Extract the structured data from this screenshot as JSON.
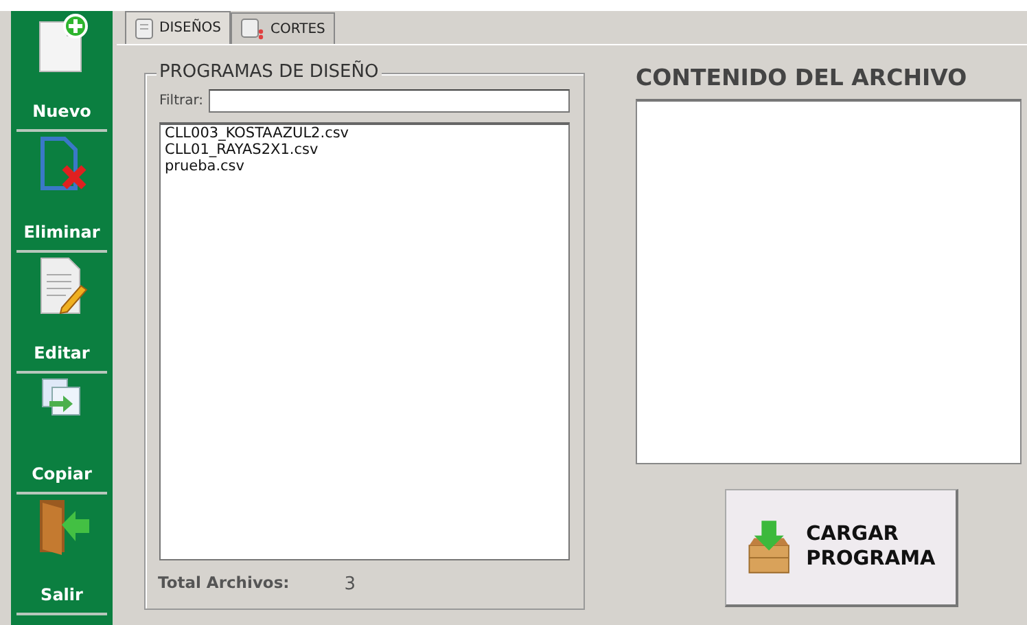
{
  "sidebar": {
    "items": [
      {
        "label": "Nuevo",
        "kind": "new"
      },
      {
        "label": "Eliminar",
        "kind": "delete"
      },
      {
        "label": "Editar",
        "kind": "edit"
      },
      {
        "label": "Copiar",
        "kind": "copy"
      },
      {
        "label": "Salir",
        "kind": "exit"
      }
    ]
  },
  "tabs": [
    {
      "label": "DISEÑOS",
      "selected": true,
      "kind": "document"
    },
    {
      "label": "CORTES",
      "selected": false,
      "kind": "cut"
    }
  ],
  "programs_panel": {
    "title": "PROGRAMAS DE DISEÑO",
    "filter": {
      "label": "Filtrar:"
    },
    "files": [
      "CLL003_KOSTAAZUL2.csv",
      "CLL01_RAYAS2X1.csv",
      "prueba.csv"
    ],
    "total_label": "Total Archivos:",
    "total": "3"
  },
  "content_panel": {
    "title": "CONTENIDO DEL ARCHIVO"
  },
  "load_button": {
    "label": "CARGAR PROGRAMA"
  }
}
